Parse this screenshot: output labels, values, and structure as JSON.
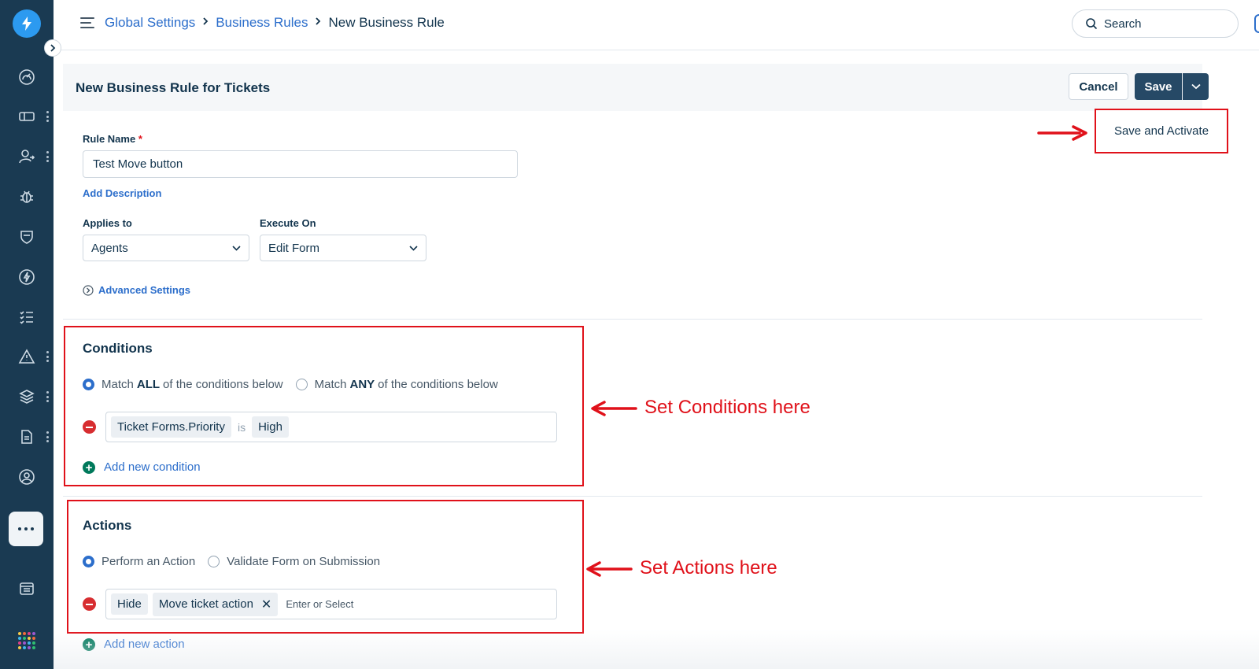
{
  "colors": {
    "sidebar": "#1a3a52",
    "accent": "#2c6ecb",
    "annotation": "#e0111a",
    "save_button": "#264966"
  },
  "sidebar": {
    "logo_icon": "lightning-logo-icon",
    "items": [
      "dashboard-icon",
      "tickets-icon",
      "contacts-icon",
      "bug-icon",
      "shield-icon",
      "automation-icon",
      "tasks-icon",
      "alert-icon",
      "layers-icon",
      "documents-icon",
      "admin-icon",
      "more-icon",
      "catalog-icon",
      "apps-icon"
    ]
  },
  "breadcrumb": {
    "items": [
      "Global Settings",
      "Business Rules"
    ],
    "current": "New Business Rule"
  },
  "search": {
    "placeholder": "Search"
  },
  "header": {
    "title": "New Business Rule for Tickets",
    "cancel_label": "Cancel",
    "save_label": "Save",
    "save_activate_label": "Save and Activate"
  },
  "form": {
    "rule_name_label": "Rule Name",
    "required_mark": "*",
    "rule_name_value": "Test Move button",
    "add_description": "Add Description",
    "applies_to_label": "Applies to",
    "applies_to_value": "Agents",
    "execute_on_label": "Execute On",
    "execute_on_value": "Edit Form",
    "advanced_settings": "Advanced Settings"
  },
  "conditions": {
    "title": "Conditions",
    "match_all_pre": "Match",
    "match_all_bold": "ALL",
    "match_all_post": "of the conditions below",
    "match_any_pre": "Match",
    "match_any_bold": "ANY",
    "match_any_post": "of the conditions below",
    "field": "Ticket Forms.Priority",
    "operator": "is",
    "value": "High",
    "add_label": "Add new condition"
  },
  "actions": {
    "title": "Actions",
    "perform_label": "Perform an Action",
    "validate_label": "Validate Form on Submission",
    "action_type": "Hide",
    "action_target": "Move ticket action",
    "input_placeholder": "Enter or Select",
    "add_label": "Add new action"
  },
  "annotations": {
    "conditions_note": "Set Conditions here",
    "actions_note": "Set Actions here"
  }
}
